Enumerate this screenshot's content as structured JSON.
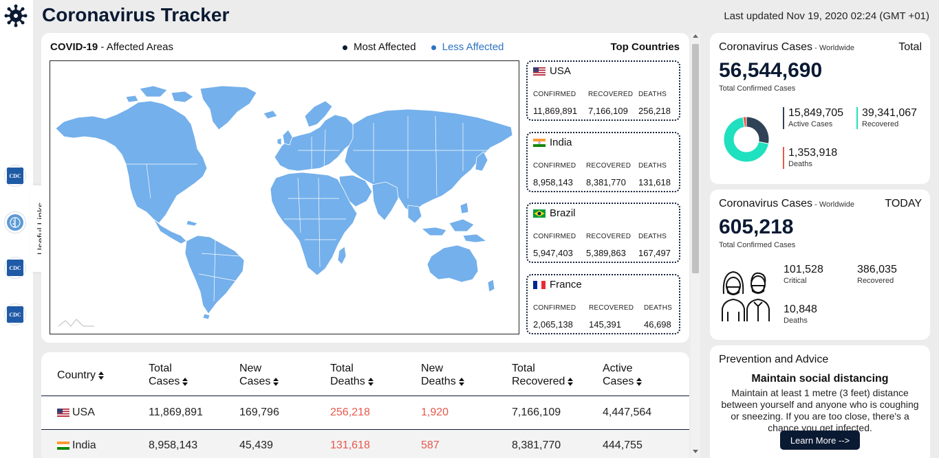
{
  "header": {
    "title": "Coronavirus Tracker",
    "last_updated": "Last updated Nov 19, 2020 02:24 (GMT +01)"
  },
  "sidebar": {
    "useful_links_label": "Useful Links",
    "links": [
      {
        "icon": "cdc-logo-icon",
        "label": "CDC"
      },
      {
        "icon": "who-logo-icon"
      },
      {
        "icon": "cdc-logo-icon",
        "label": "CDC"
      },
      {
        "icon": "cdc-logo-icon",
        "label": "CDC"
      }
    ]
  },
  "map": {
    "title_bold": "COVID-19",
    "title_rest": " - Affected Areas",
    "legend_most": "Most Affected",
    "legend_less": "Less Affected",
    "top_countries_title": "Top Countries",
    "land_color": "#74b0eb"
  },
  "top_countries": {
    "col_confirmed": "CONFIRMED",
    "col_recovered": "RECOVERED",
    "col_deaths": "DEATHS",
    "items": [
      {
        "name": "USA",
        "flag": "us-flag-icon",
        "confirmed": "11,869,891",
        "recovered": "7,166,109",
        "deaths": "256,218"
      },
      {
        "name": "India",
        "flag": "india-flag-icon",
        "confirmed": "8,958,143",
        "recovered": "8,381,770",
        "deaths": "131,618"
      },
      {
        "name": "Brazil",
        "flag": "brazil-flag-icon",
        "confirmed": "5,947,403",
        "recovered": "5,389,863",
        "deaths": "167,497"
      },
      {
        "name": "France",
        "flag": "france-flag-icon",
        "confirmed": "2,065,138",
        "recovered": "145,391",
        "deaths": "46,698"
      }
    ]
  },
  "table": {
    "headers": {
      "country": "Country",
      "total_cases_1": "Total",
      "total_cases_2": "Cases",
      "new_cases_1": "New",
      "new_cases_2": "Cases",
      "total_deaths_1": "Total",
      "total_deaths_2": "Deaths",
      "new_deaths_1": "New",
      "new_deaths_2": "Deaths",
      "total_recovered_1": "Total",
      "total_recovered_2": "Recovered",
      "active_cases_1": "Active",
      "active_cases_2": "Cases"
    },
    "rows": [
      {
        "country": "USA",
        "total_cases": "11,869,891",
        "new_cases": "169,796",
        "total_deaths": "256,218",
        "new_deaths": "1,920",
        "total_recovered": "7,166,109",
        "active_cases": "4,447,564"
      },
      {
        "country": "India",
        "total_cases": "8,958,143",
        "new_cases": "45,439",
        "total_deaths": "131,618",
        "new_deaths": "587",
        "total_recovered": "8,381,770",
        "active_cases": "444,755"
      }
    ]
  },
  "total_card": {
    "title": "Coronavirus Cases",
    "scope": " - Worldwide",
    "tag": "Total",
    "big_value": "56,544,690",
    "sub_label": "Total Confirmed Cases",
    "active_value": "15,849,705",
    "active_label": "Active Cases",
    "active_color": "#2f4256",
    "recovered_value": "39,341,067",
    "recovered_label": "Recovered",
    "recovered_color": "#1fe0bf",
    "deaths_value": "1,353,918",
    "deaths_label": "Deaths",
    "deaths_color": "#e5584b",
    "donut": {
      "active": 15849705,
      "recovered": 39341067,
      "deaths": 1353918
    }
  },
  "today_card": {
    "title": "Coronavirus Cases",
    "scope": " - Worldwide",
    "tag": "TODAY",
    "big_value": "605,218",
    "sub_label": "Total Confirmed Cases",
    "critical_value": "101,528",
    "critical_label": "Critical",
    "recovered_value": "386,035",
    "recovered_label": "Recovered",
    "deaths_value": "10,848",
    "deaths_label": "Deaths"
  },
  "advice_card": {
    "title": "Prevention and Advice",
    "headline": "Maintain social distancing",
    "body": "Maintain at least 1 metre (3 feet) distance between yourself and anyone who is coughing or sneezing. If you are too close, there's a chance you get infected.",
    "button": "Learn More -->"
  }
}
